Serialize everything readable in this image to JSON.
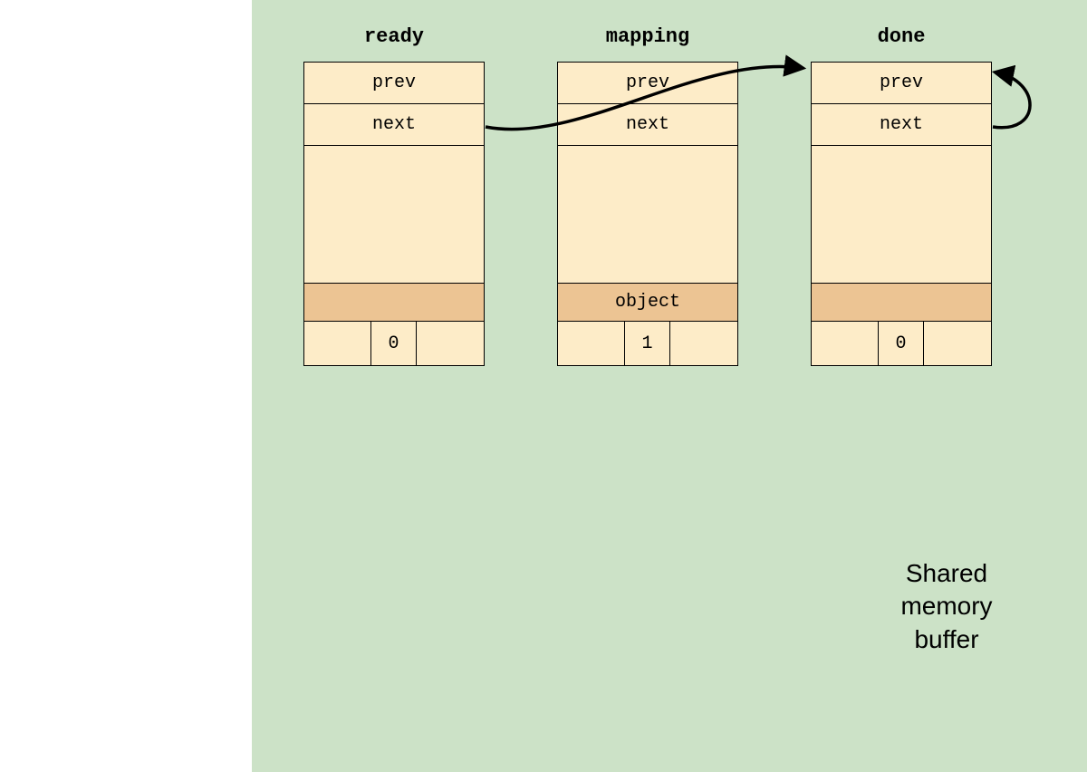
{
  "columns": [
    {
      "label": "ready",
      "prev": "prev",
      "next": "next",
      "object": "",
      "counter": "0"
    },
    {
      "label": "mapping",
      "prev": "prev",
      "next": "next",
      "object": "object",
      "counter": "1"
    },
    {
      "label": "done",
      "prev": "prev",
      "next": "next",
      "object": "",
      "counter": "0"
    }
  ],
  "caption": {
    "line1": "Shared",
    "line2": "memory",
    "line3": "buffer"
  }
}
